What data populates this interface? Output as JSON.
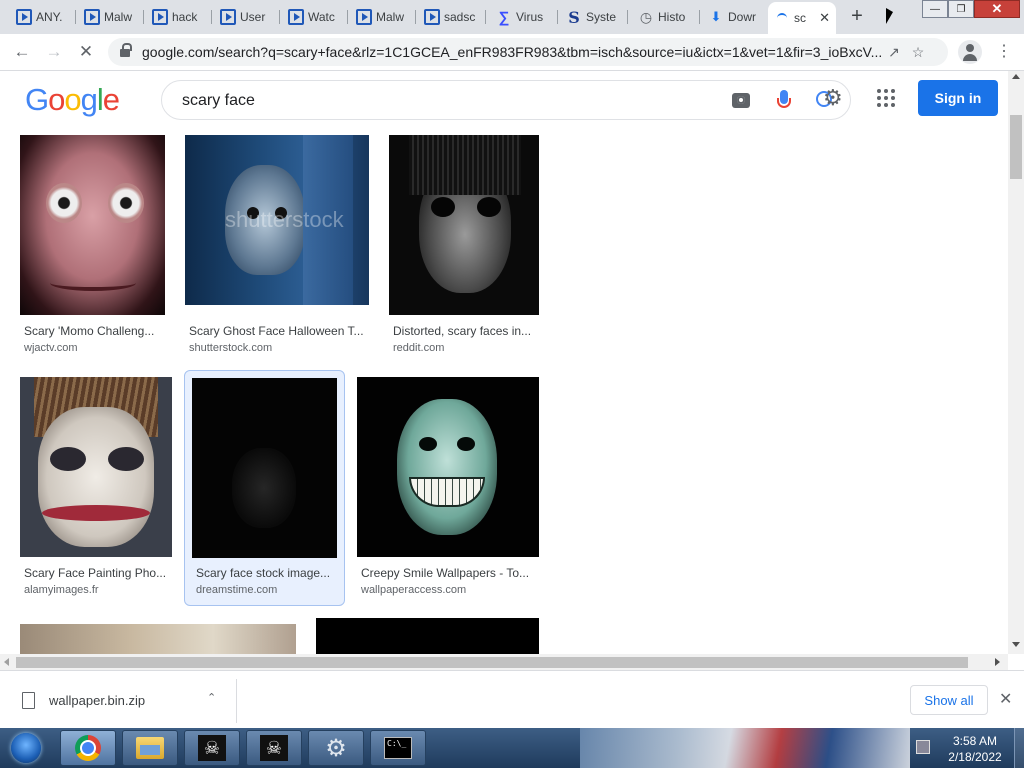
{
  "browser": {
    "tabs": [
      {
        "label": "ANY.",
        "icon": "anyrun-icon"
      },
      {
        "label": "Malw",
        "icon": "anyrun-icon"
      },
      {
        "label": "hack",
        "icon": "anyrun-icon"
      },
      {
        "label": "User",
        "icon": "anyrun-icon"
      },
      {
        "label": "Watc",
        "icon": "anyrun-icon"
      },
      {
        "label": "Malw",
        "icon": "anyrun-icon"
      },
      {
        "label": "sadsc",
        "icon": "anyrun-icon"
      },
      {
        "label": "Virus",
        "icon": "virustotal-icon"
      },
      {
        "label": "Syste",
        "icon": "s-logo-icon"
      },
      {
        "label": "Histo",
        "icon": "history-icon"
      },
      {
        "label": "Dowr",
        "icon": "download-icon"
      },
      {
        "label": "sc",
        "icon": "loading-spinner-icon"
      }
    ],
    "url": "google.com/search?q=scary+face&rlz=1C1GCEA_enFR983FR983&tbm=isch&source=iu&ictx=1&vet=1&fir=3_ioBxcV..."
  },
  "google": {
    "logo": [
      "G",
      "o",
      "o",
      "g",
      "l",
      "e"
    ],
    "logo_colors": [
      "#4285f4",
      "#ea4335",
      "#fbbc05",
      "#4285f4",
      "#34a853",
      "#ea4335"
    ],
    "query": "scary face",
    "signin_label": "Sign in"
  },
  "results": [
    {
      "title": "Scary 'Momo Challeng...",
      "source": "wjactv.com"
    },
    {
      "title": "Scary Ghost Face Halloween T...",
      "source": "shutterstock.com",
      "watermark": "shutterstock"
    },
    {
      "title": "Distorted, scary faces in...",
      "source": "reddit.com"
    },
    {
      "title": "Scary Face Painting Pho...",
      "source": "alamyimages.fr"
    },
    {
      "title": "Scary face stock image...",
      "source": "dreamstime.com"
    },
    {
      "title": "Creepy Smile Wallpapers - To...",
      "source": "wallpaperaccess.com"
    }
  ],
  "download": {
    "filename": "wallpaper.bin.zip",
    "show_all_label": "Show all"
  },
  "taskbar": {
    "time": "3:58 AM",
    "date": "2/18/2022"
  }
}
